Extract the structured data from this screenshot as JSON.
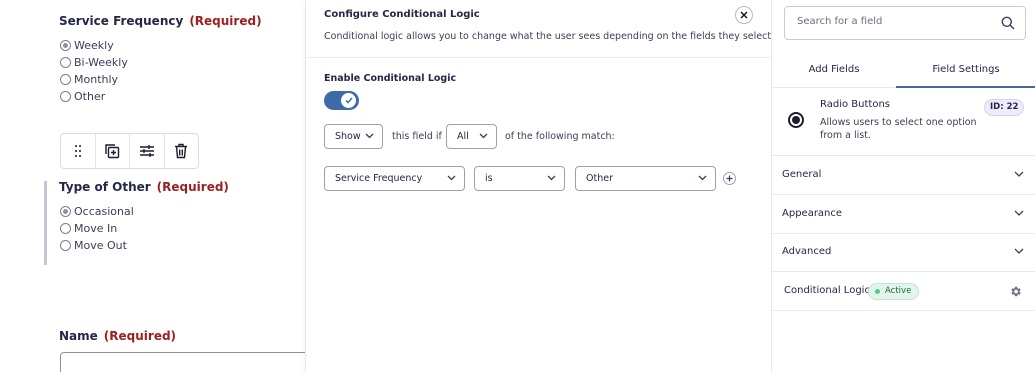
{
  "canvas": {
    "service_frequency": {
      "label": "Service Frequency",
      "required": "(Required)",
      "options": [
        "Weekly",
        "Bi-Weekly",
        "Monthly",
        "Other"
      ],
      "selected": "Weekly"
    },
    "toolbar": {
      "icons": [
        "drag-handle-icon",
        "duplicate-icon",
        "settings-sliders-icon",
        "trash-icon"
      ]
    },
    "type_of_other": {
      "label": "Type of Other",
      "required": "(Required)",
      "options": [
        "Occasional",
        "Move In",
        "Move Out"
      ],
      "selected": "Occasional"
    },
    "name_field": {
      "label": "Name",
      "required": "(Required)",
      "value": ""
    }
  },
  "modal": {
    "title": "Configure Conditional Logic",
    "description": "Conditional logic allows you to change what the user sees depending on the fields they select.",
    "enable_label": "Enable Conditional Logic",
    "enabled": true,
    "action_select": "Show",
    "text_this_field_if": "this field if",
    "match_select": "All",
    "text_of_following": "of the following match:",
    "rule": {
      "field": "Service Frequency",
      "operator": "is",
      "value": "Other"
    }
  },
  "panel": {
    "search_placeholder": "Search for a field",
    "tabs": [
      "Add Fields",
      "Field Settings"
    ],
    "active_tab": "Field Settings",
    "field_type": "Radio Buttons",
    "field_desc": "Allows users to select one option from a list.",
    "field_id": "ID: 22",
    "sections": [
      "General",
      "Appearance",
      "Advanced"
    ],
    "conditional_logic_label": "Conditional Logic",
    "conditional_logic_status": "Active"
  },
  "colors": {
    "required": "#9b1f1f",
    "accent": "#3e6ba6",
    "active_badge": "#e3f5ea"
  }
}
